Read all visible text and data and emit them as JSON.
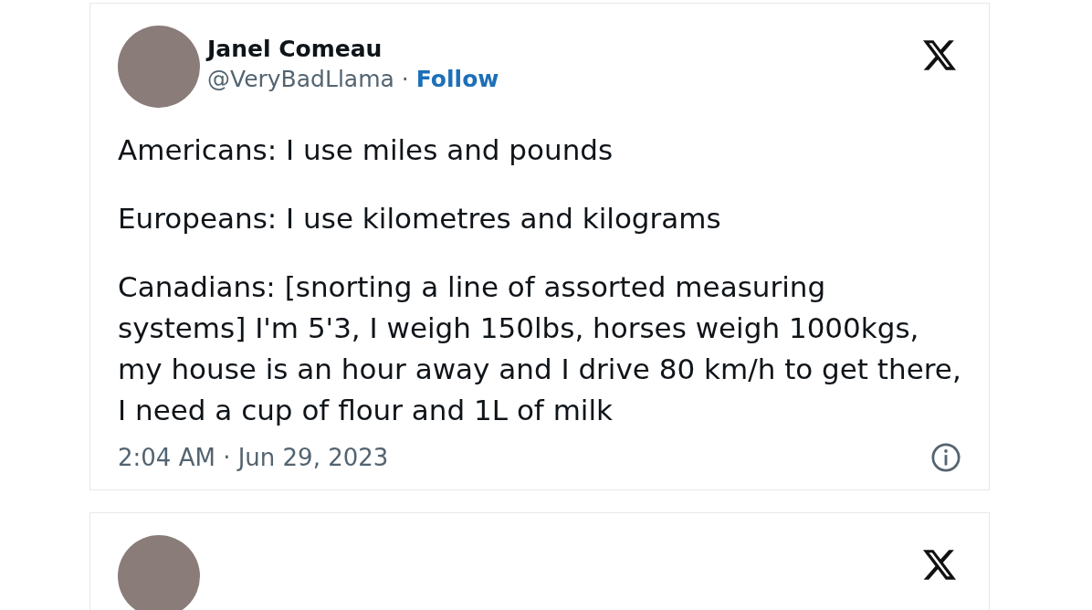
{
  "tweet": {
    "author_name": "Janel Comeau",
    "handle": "@VeryBadLlama",
    "separator": "·",
    "follow": "Follow",
    "paragraphs": [
      "Americans: I use miles and pounds",
      "Europeans: I use kilometres and kilograms",
      "Canadians: [snorting a line of assorted measuring systems] I'm 5'3, I weigh 150lbs, horses weigh 1000kgs, my house is an hour away and I drive 80 km/h to get there, I need a cup of flour and 1L of milk"
    ],
    "timestamp": "2:04 AM · Jun 29, 2023"
  }
}
